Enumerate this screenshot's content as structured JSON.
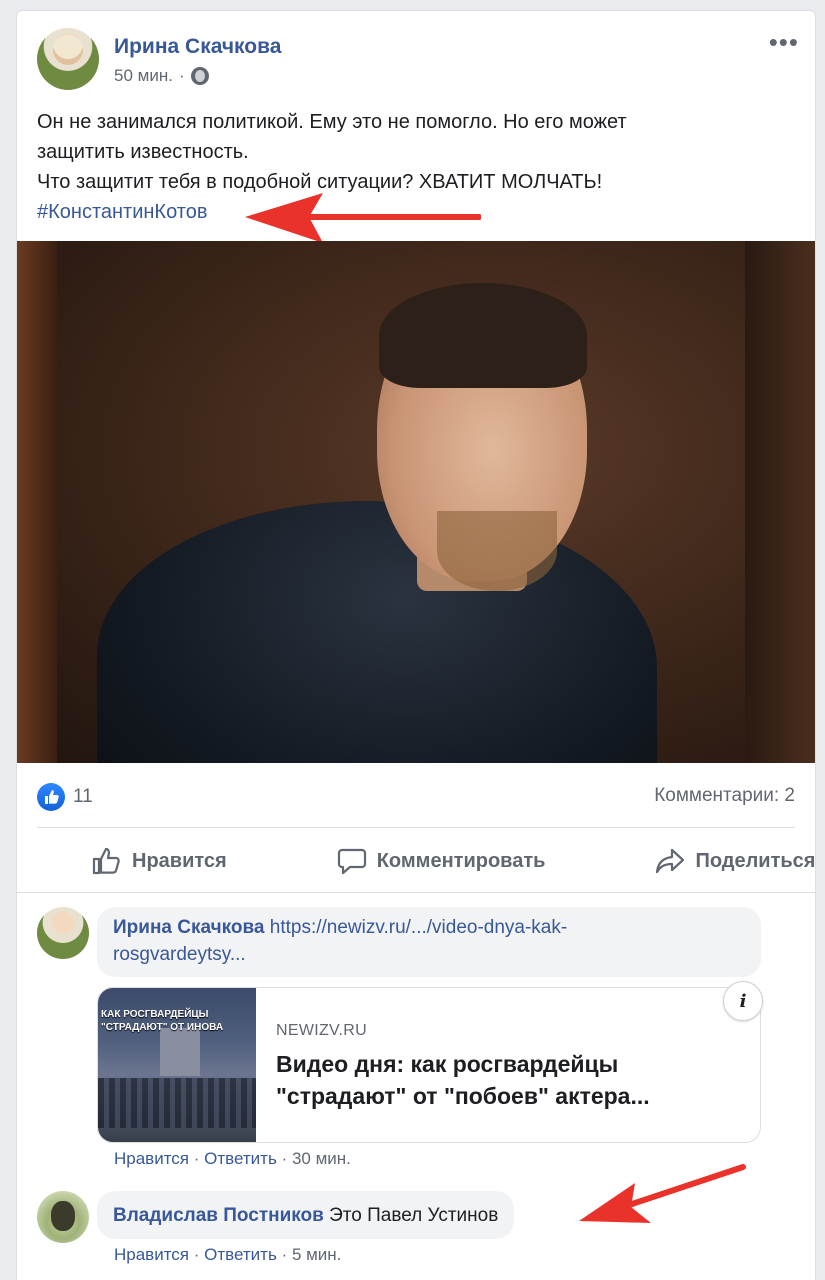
{
  "post": {
    "author": "Ирина Скачкова",
    "time": "50 мин.",
    "time_separator": "·",
    "more_label": "•••",
    "text_lines": [
      "Он не занимался политикой. Ему это не помогло. Но его может",
      "защитить известность.",
      "Что защитит тебя в подобной ситуации? ХВАТИТ МОЛЧАТЬ!"
    ],
    "hashtag": "#КонстантинКотов",
    "like_count": "11",
    "comments_label": "Комментарии: 2",
    "actions": {
      "like": "Нравится",
      "comment": "Комментировать",
      "share": "Поделиться"
    }
  },
  "comments": [
    {
      "author": "Ирина Скачкова",
      "link_text_1": "https://newizv.ru/.../video-dnya-kak-",
      "link_text_2": "rosgvardeytsy...",
      "preview": {
        "thumb_text": "КАК РОСГВАРДЕЙЦЫ \"СТРАДАЮТ\" ОТ ИНОВА",
        "domain": "NEWIZV.RU",
        "title": "Видео дня: как росгвардейцы \"страдают\" от \"побоев\" актера..."
      },
      "like": "Нравится",
      "reply": "Ответить",
      "time": "30 мин."
    },
    {
      "author": "Владислав Постников",
      "text": "Это Павел Устинов",
      "like": "Нравится",
      "reply": "Ответить",
      "time": "5 мин."
    }
  ],
  "colors": {
    "link": "#385898",
    "annotation_arrow": "#e8322a",
    "like_badge": "#1877f2"
  }
}
